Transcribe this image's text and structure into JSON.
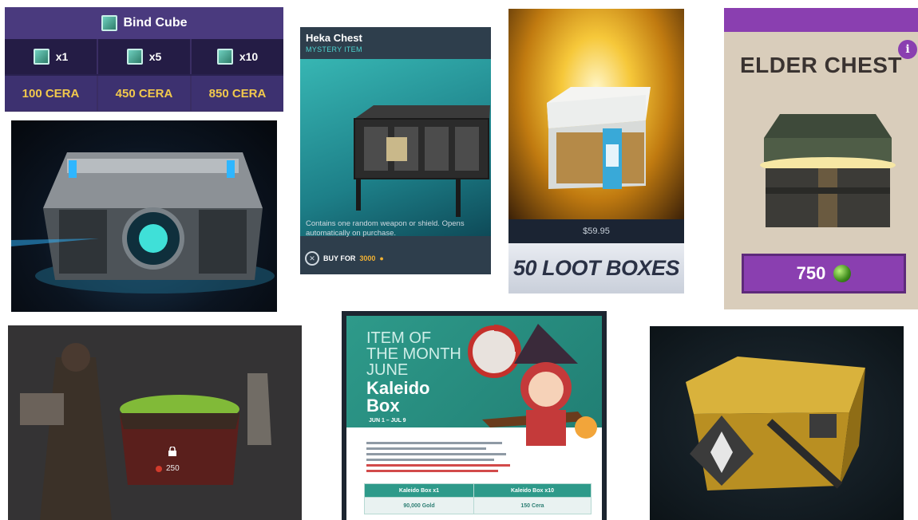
{
  "bind_cube": {
    "title": "Bind Cube",
    "quantities": [
      "x1",
      "x5",
      "x10"
    ],
    "prices": [
      "100 CERA",
      "450 CERA",
      "850 CERA"
    ]
  },
  "heka_chest": {
    "title": "Heka Chest",
    "subtitle": "MYSTERY ITEM",
    "description": "Contains one random weapon or shield. Opens automatically on purchase.",
    "buy_label": "BUY FOR",
    "buy_amount": "3000"
  },
  "loot_boxes": {
    "price": "$59.95",
    "label": "50 LOOT BOXES"
  },
  "elder_chest": {
    "title": "ELDER CHEST",
    "info": "i",
    "price": "750"
  },
  "dungeon": {
    "chest_cost": "250"
  },
  "kaleido": {
    "heading_lines": [
      "ITEM OF",
      "THE MONTH",
      "JUNE"
    ],
    "name_lines": [
      "Kaleido",
      "Box"
    ],
    "dates": "JUN 1 – JUL 9",
    "table_headers": [
      "Kaleido Box x1",
      "Kaleido Box x10"
    ],
    "table_values": [
      "90,000 Gold",
      "150 Cera"
    ]
  },
  "colors": {
    "bind_purple": "#3a2d63",
    "cera_gold": "#f2c94c",
    "elder_purple": "#8a3fb0",
    "kaleido_teal": "#2e9a8a"
  }
}
